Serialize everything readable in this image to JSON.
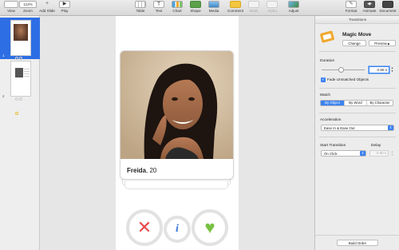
{
  "toolbar": {
    "view": "View",
    "zoom": "Zoom",
    "zoom_value": "112%",
    "add_slide": "Add Slide",
    "play": "Play",
    "table": "Table",
    "text": "Text",
    "chart": "Chart",
    "shape": "Shape",
    "media": "Media",
    "comment": "Comment",
    "mask": "Mask",
    "alpha": "Alpha",
    "adjust": "Adjust",
    "format": "Format",
    "animate": "Animate",
    "document": "Document"
  },
  "navigator": {
    "slides": [
      {
        "number": "1",
        "selected": true
      },
      {
        "number": "2",
        "selected": false
      }
    ]
  },
  "slide": {
    "name": "Freida",
    "age": ", 20"
  },
  "inspector": {
    "tab_title": "Transitions",
    "effect_name": "Magic Move",
    "change_button": "Change",
    "preview_button": "Preview",
    "duration_label": "Duration",
    "duration_value": "0.90 s",
    "fade_checkbox_label": "Fade Unmatched Objects",
    "fade_checked": true,
    "match_label": "Match",
    "match_options": [
      "By Object",
      "By Word",
      "By Character"
    ],
    "match_selected": 0,
    "acceleration_label": "Acceleration",
    "acceleration_value": "Ease In & Ease Out",
    "start_label": "Start Transition",
    "start_value": "On Click",
    "delay_label": "Delay",
    "delay_value": "0.00 s",
    "build_order_button": "Build Order"
  },
  "colors": {
    "accent": "#2d6ee4",
    "nope": "#e84a4a",
    "info": "#3a78d8",
    "like": "#79c142"
  }
}
